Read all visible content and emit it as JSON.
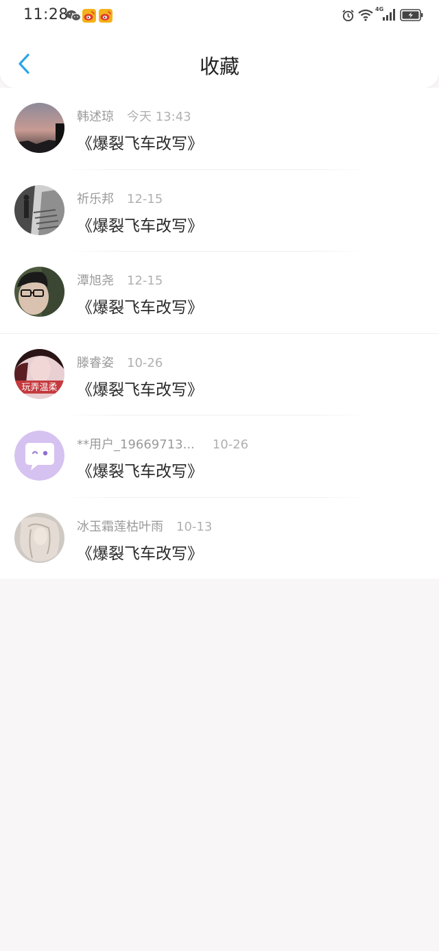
{
  "status_bar": {
    "time": "11:28",
    "left_icons": [
      "wechat-icon",
      "weibo-icon",
      "weibo-icon"
    ],
    "right_icons": [
      "alarm-icon",
      "wifi-icon",
      "signal-4g-icon",
      "battery-icon"
    ],
    "network_label": "4G"
  },
  "header": {
    "title": "收藏",
    "back_icon": "chevron-left-icon",
    "accent_color": "#2aa5e8"
  },
  "favorites": [
    {
      "name": "韩述琼",
      "date": "今天 13:43",
      "message": "《爆裂飞车改写》"
    },
    {
      "name": "祈乐邦",
      "date": "12-15",
      "message": "《爆裂飞车改写》"
    },
    {
      "name": "潭旭尧",
      "date": "12-15",
      "message": "《爆裂飞车改写》"
    },
    {
      "name": "滕睿姿",
      "date": "10-26",
      "message": "《爆裂飞车改写》",
      "avatar_caption": "玩弄温柔"
    },
    {
      "name": "**用户_19669713...",
      "date": "10-26",
      "message": "《爆裂飞车改写》"
    },
    {
      "name": "冰玉霜莲枯叶雨",
      "date": "10-13",
      "message": "《爆裂飞车改写》"
    }
  ]
}
